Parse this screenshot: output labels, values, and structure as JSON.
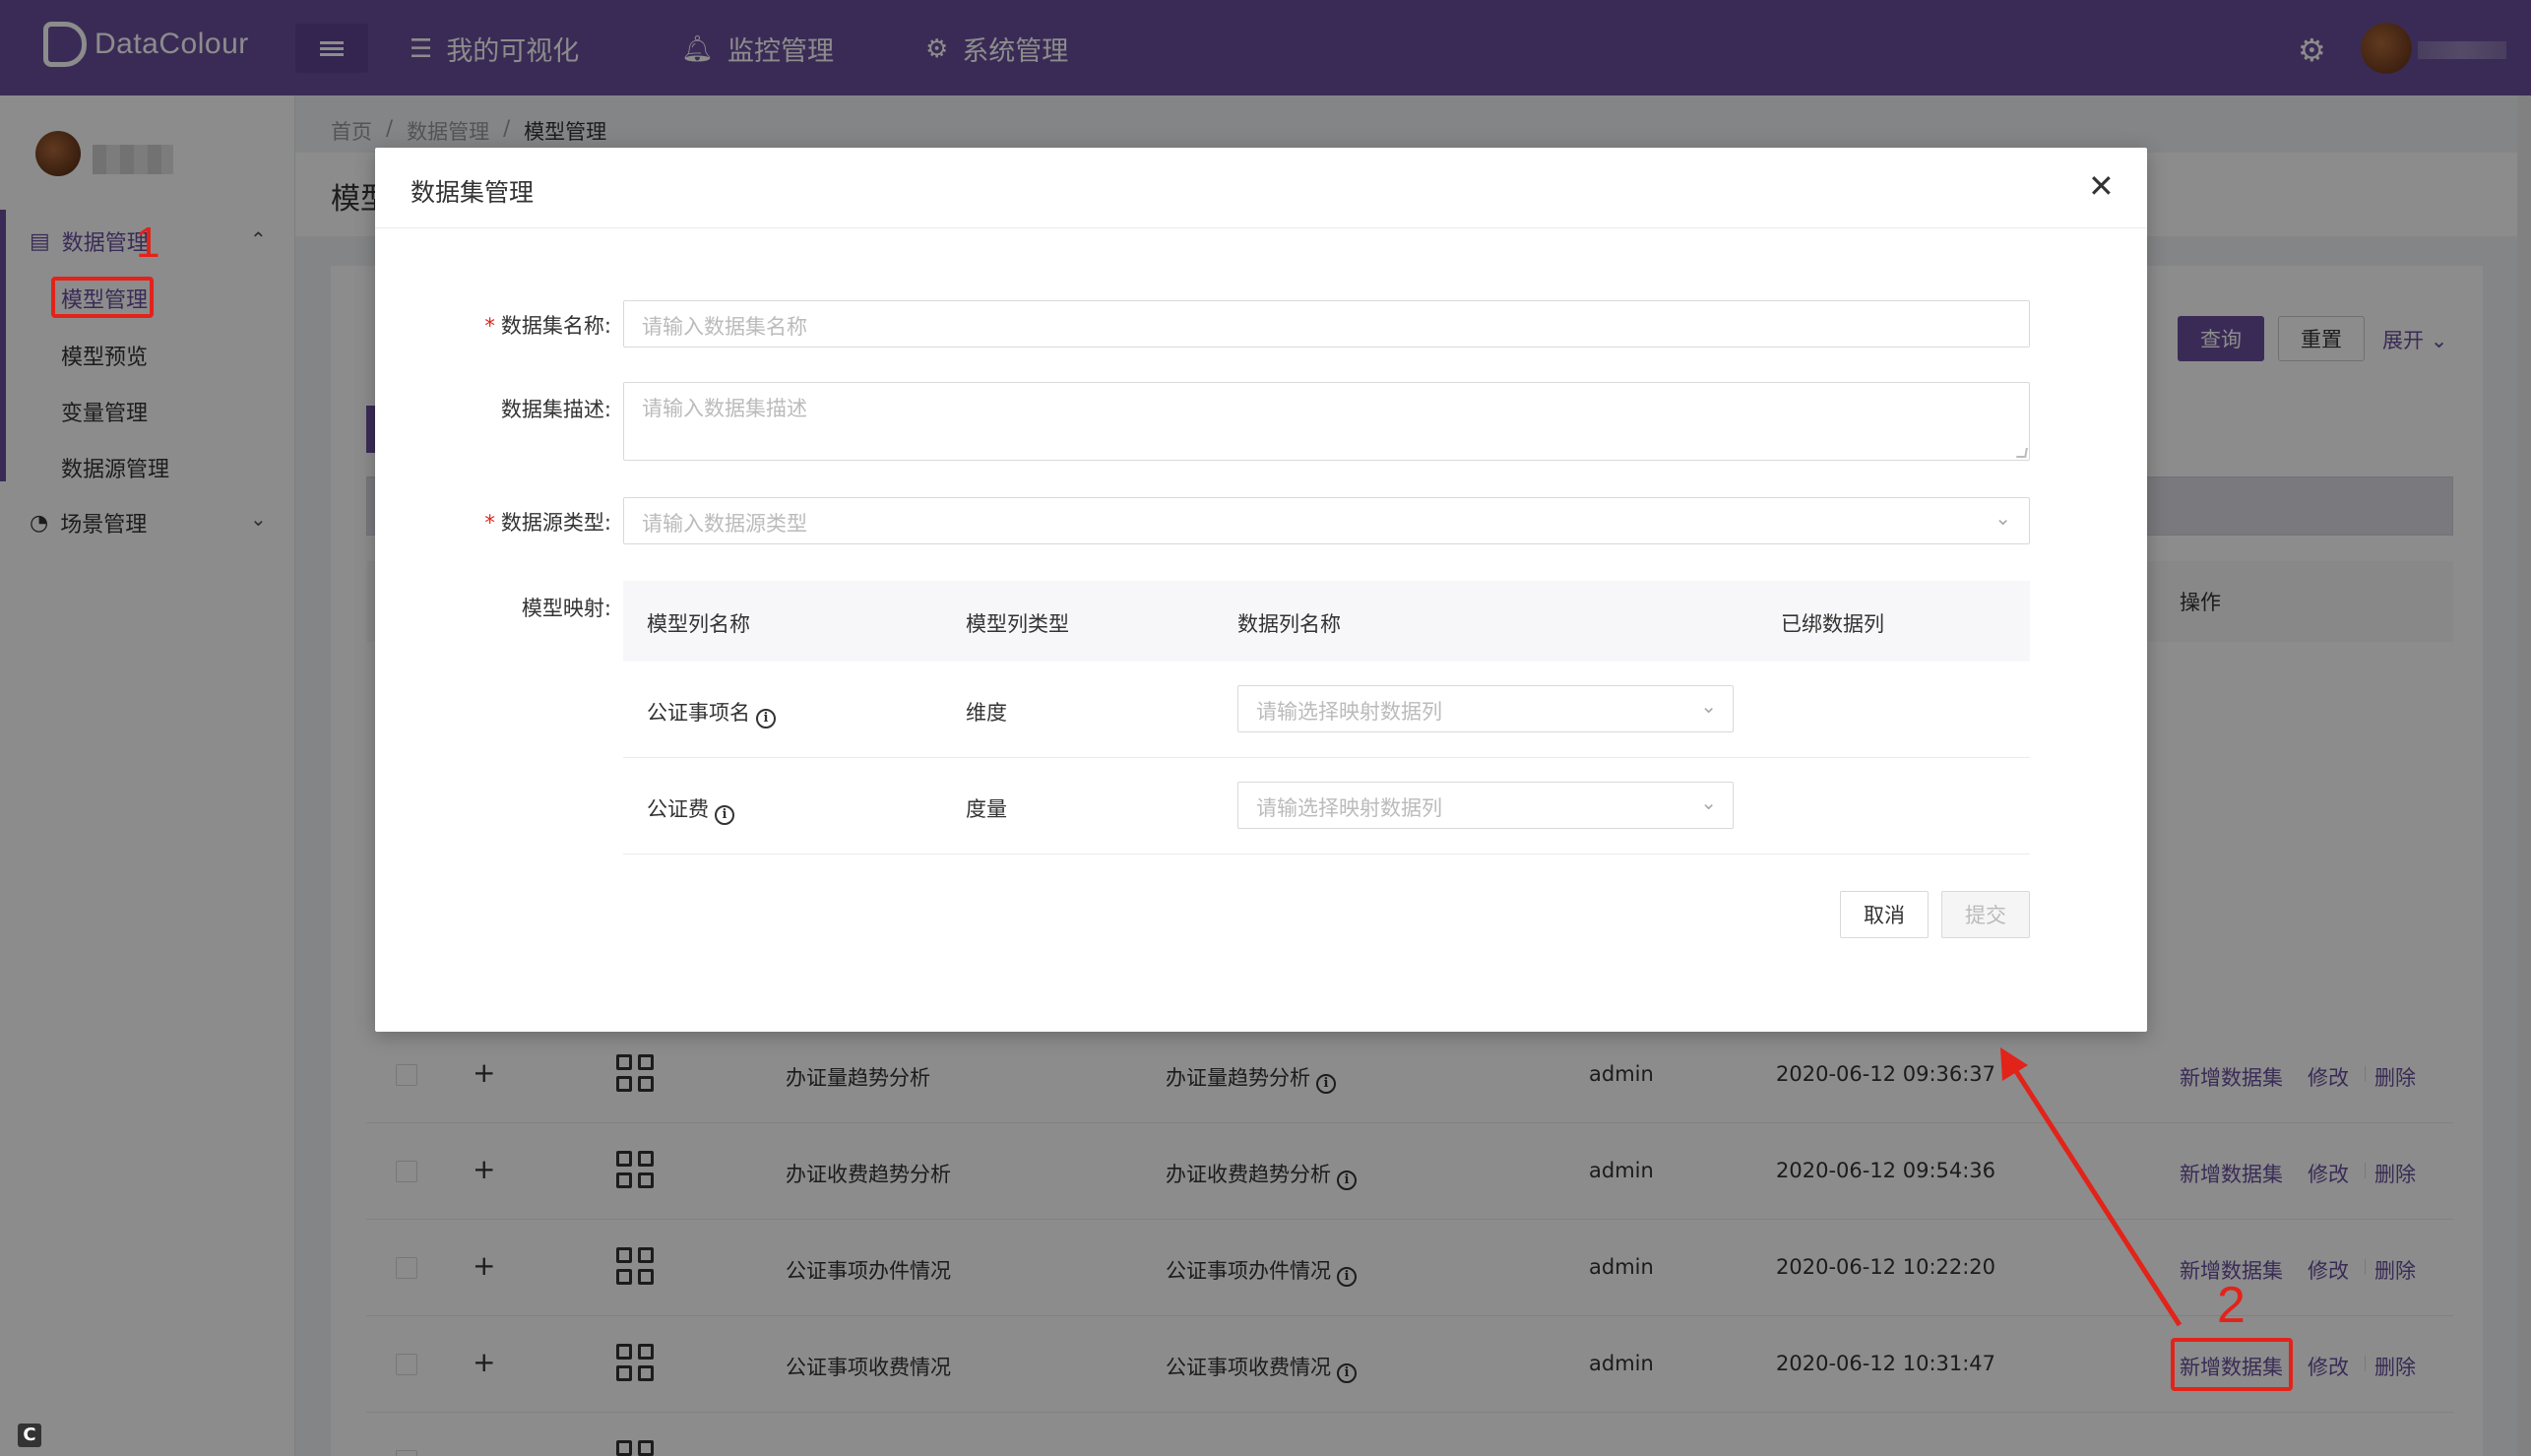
{
  "app": {
    "brand": "DataColour"
  },
  "topnav": {
    "items": [
      {
        "label": "我的可视化",
        "icon": "list-icon"
      },
      {
        "label": "监控管理",
        "icon": "bell-icon"
      },
      {
        "label": "系统管理",
        "icon": "gear-icon"
      }
    ]
  },
  "sidebar": {
    "groups": [
      {
        "label": "数据管理",
        "icon": "table-icon",
        "expanded": true,
        "items": [
          "模型管理",
          "模型预览",
          "变量管理",
          "数据源管理"
        ],
        "active": "模型管理"
      },
      {
        "label": "场景管理",
        "icon": "dashboard-icon",
        "expanded": false,
        "items": []
      }
    ]
  },
  "breadcrumb": [
    "首页",
    "数据管理",
    "模型管理"
  ],
  "page": {
    "title": "模型"
  },
  "search": {
    "query_label": "查询",
    "reset_label": "重置",
    "expand_label": "展开"
  },
  "table": {
    "op_header": "操作",
    "actions": {
      "add": "新增数据集",
      "edit": "修改",
      "delete": "删除"
    },
    "rows": [
      {
        "name": "办证量趋势分析",
        "alias": "办证量趋势分析",
        "owner": "admin",
        "time": "2020-06-12 09:36:37"
      },
      {
        "name": "办证收费趋势分析",
        "alias": "办证收费趋势分析",
        "owner": "admin",
        "time": "2020-06-12 09:54:36"
      },
      {
        "name": "公证事项办件情况",
        "alias": "公证事项办件情况",
        "owner": "admin",
        "time": "2020-06-12 10:22:20"
      },
      {
        "name": "公证事项收费情况",
        "alias": "公证事项收费情况",
        "owner": "admin",
        "time": "2020-06-12 10:31:47"
      }
    ]
  },
  "modal": {
    "title": "数据集管理",
    "fields": {
      "name": {
        "label": "数据集名称",
        "placeholder": "请输入数据集名称",
        "required": true
      },
      "desc": {
        "label": "数据集描述",
        "placeholder": "请输入数据集描述",
        "required": false
      },
      "source_type": {
        "label": "数据源类型",
        "placeholder": "请输入数据源类型",
        "required": true
      },
      "mapping": {
        "label": "模型映射"
      }
    },
    "mapping_table": {
      "headers": [
        "模型列名称",
        "模型列类型",
        "数据列名称",
        "已绑数据列"
      ],
      "rows": [
        {
          "column": "公证事项名",
          "type": "维度",
          "placeholder": "请输选择映射数据列"
        },
        {
          "column": "公证费",
          "type": "度量",
          "placeholder": "请输选择映射数据列"
        }
      ]
    },
    "cancel_label": "取消",
    "submit_label": "提交"
  },
  "annotations": {
    "one": "1",
    "two": "2",
    "color": "#e2231a"
  },
  "colors": {
    "primary": "#6a4f9d",
    "danger": "#e2231a"
  }
}
